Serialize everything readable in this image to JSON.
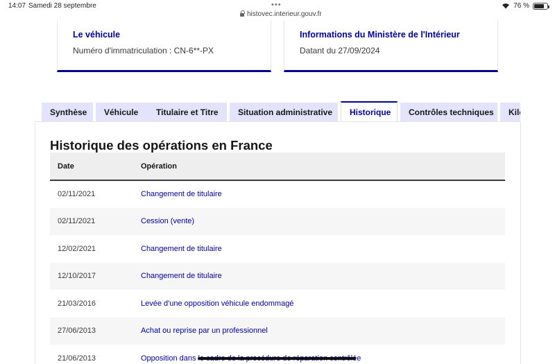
{
  "status_bar": {
    "time": "14:07",
    "date": "Samedi 28 septembre",
    "url": "histovec.interieur.gouv.fr",
    "battery": "76 %",
    "battery_level": 0.76
  },
  "cards": [
    {
      "title": "Le véhicule",
      "text": "Numéro d'immatriculation : CN-6**-PX"
    },
    {
      "title": "Informations du Ministère de l'Intérieur",
      "text": "Datant du 27/09/2024"
    }
  ],
  "tabs": [
    {
      "label": "Synthèse",
      "active": false
    },
    {
      "label": "Véhicule",
      "active": false
    },
    {
      "label": "Titulaire et Titre",
      "active": false
    },
    {
      "label": "Situation administrative",
      "active": false
    },
    {
      "label": "Historique",
      "active": true
    },
    {
      "label": "Contrôles techniques",
      "active": false
    },
    {
      "label": "Kilo",
      "active": false
    }
  ],
  "history": {
    "title": "Historique des opérations en France",
    "headers": {
      "date": "Date",
      "operation": "Opération"
    },
    "rows": [
      {
        "date": "02/11/2021",
        "operation": "Changement de titulaire"
      },
      {
        "date": "02/11/2021",
        "operation": "Cession (vente)"
      },
      {
        "date": "12/02/2021",
        "operation": "Changement de titulaire"
      },
      {
        "date": "12/10/2017",
        "operation": "Changement de titulaire"
      },
      {
        "date": "21/03/2016",
        "operation": "Levée d'une opposition véhicule endommagé"
      },
      {
        "date": "27/06/2013",
        "operation": "Achat ou reprise par un professionnel"
      },
      {
        "date": "21/06/2013",
        "operation": "Opposition dans le cadre de la procédure de réparation contrôlée"
      }
    ]
  },
  "colors": {
    "accent": "#000091",
    "tab_bg": "#e3e3fd",
    "row_alt": "#f6f6f6",
    "header_bg": "#eeeeee"
  }
}
